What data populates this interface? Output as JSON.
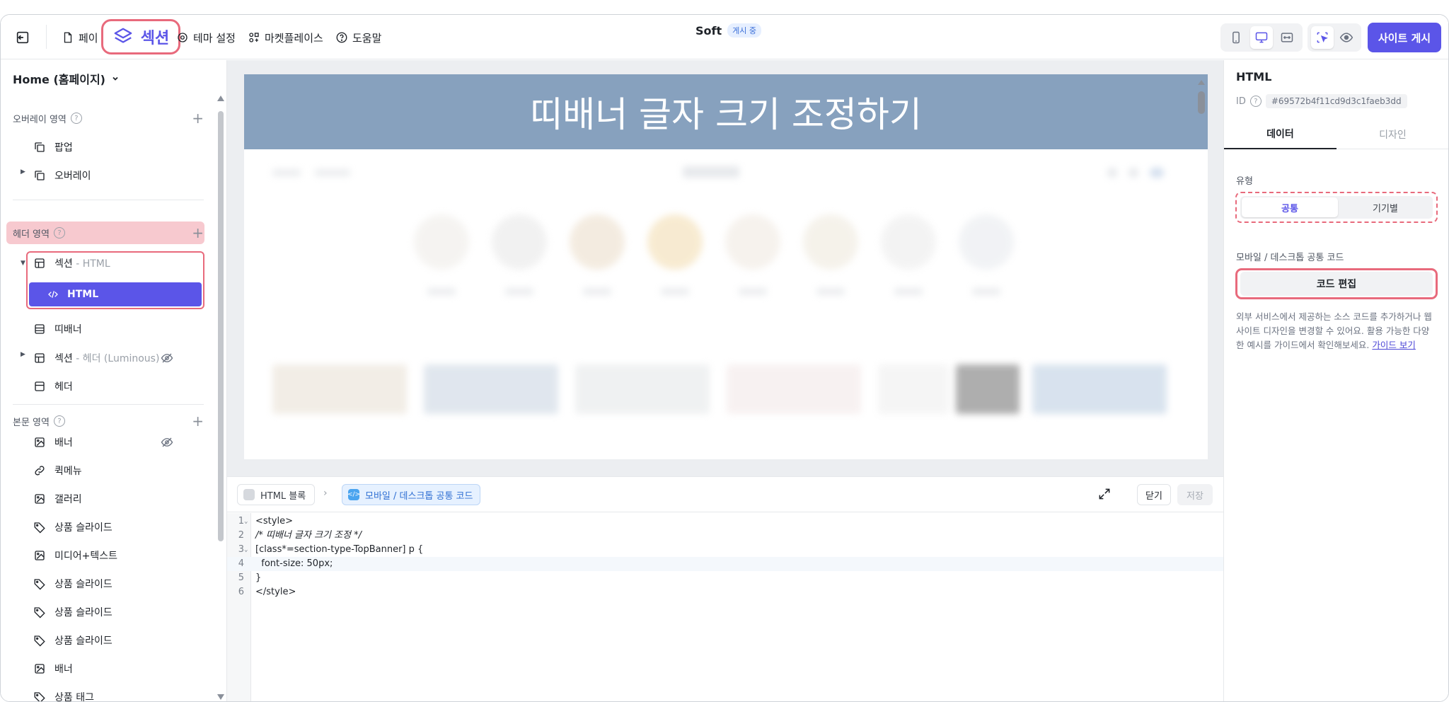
{
  "colors": {
    "accent": "#5b55e8",
    "highlight_border": "#e86a7c",
    "banner_bg": "#87a1be"
  },
  "topbar": {
    "nav": [
      {
        "label": "페이",
        "icon": "page-icon"
      },
      {
        "label": "섹션",
        "icon": "layers-icon"
      },
      {
        "label": "테마 설정",
        "icon": "theme-icon"
      },
      {
        "label": "마켓플레이스",
        "icon": "marketplace-icon"
      },
      {
        "label": "도움말",
        "icon": "help-icon"
      }
    ],
    "site_name": "Soft",
    "status_badge": "게시 중",
    "publish_label": "사이트 게시"
  },
  "sidebar": {
    "page_select": "Home (홈페이지)",
    "groups": {
      "overlay": "오버레이 영역",
      "header": "헤더 영역",
      "body": "본문 영역"
    },
    "overlay_items": [
      "팝업",
      "오버레이"
    ],
    "header_items": [
      {
        "label": "섹션",
        "sub": " - HTML"
      },
      {
        "label": "HTML"
      },
      {
        "label": "띠배너"
      },
      {
        "label": "섹션",
        "sub": " - 헤더 (Luminous)"
      },
      {
        "label": "헤더"
      }
    ],
    "body_items": [
      "배너",
      "퀵메뉴",
      "갤러리",
      "상품 슬라이드",
      "미디어+텍스트",
      "상품 슬라이드",
      "상품 슬라이드",
      "상품 슬라이드",
      "배너",
      "상품 태그"
    ]
  },
  "preview": {
    "banner_text": "띠배너 글자 크기 조정하기"
  },
  "editor": {
    "crumb_block": "HTML 블록",
    "crumb_code": "모바일 / 데스크톱 공통 코드",
    "close_label": "닫기",
    "save_label": "저장",
    "lines": [
      {
        "n": "1",
        "text": "<style>"
      },
      {
        "n": "2",
        "text": "/* 띠배너 글자 크기 조정 */"
      },
      {
        "n": "3",
        "text": "[class*=section-type-TopBanner] p {"
      },
      {
        "n": "4",
        "text": "  font-size: 50px;"
      },
      {
        "n": "5",
        "text": "}"
      },
      {
        "n": "6",
        "text": "</style>"
      }
    ]
  },
  "rpanel": {
    "title": "HTML",
    "id_label": "ID",
    "id_value": "#69572b4f11cd9d3c1faeb3dd",
    "tab_data": "데이터",
    "tab_design": "디자인",
    "type_label": "유형",
    "type_common": "공통",
    "type_device": "기기별",
    "code_label": "모바일 / 데스크톱 공통 코드",
    "code_edit": "코드 편집",
    "desc": "외부 서비스에서 제공하는 소스 코드를 추가하거나 웹사이트 디자인을 변경할 수 있어요. 활용 가능한 다양한 예시를 가이드에서 확인해보세요.",
    "guide_link": "가이드 보기"
  }
}
